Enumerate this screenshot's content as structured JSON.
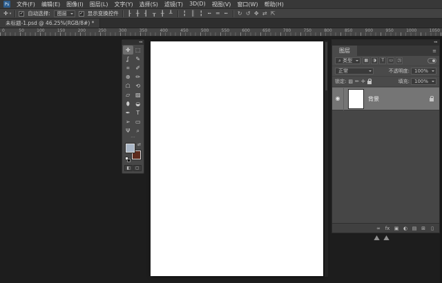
{
  "menubar": {
    "logo": "Ps",
    "items": [
      "文件(F)",
      "编辑(E)",
      "图像(I)",
      "图层(L)",
      "文字(Y)",
      "选择(S)",
      "滤镜(T)",
      "3D(D)",
      "视图(V)",
      "窗口(W)",
      "帮助(H)"
    ]
  },
  "options_bar": {
    "tool_icon": "✛",
    "auto_select_checked": "✓",
    "auto_select_label": "自动选择:",
    "auto_select_value": "图层",
    "show_transform_checked": "✓",
    "show_transform_label": "显示变换控件",
    "align_icons": [
      {
        "name": "align-left-icon",
        "glyph": "┠"
      },
      {
        "name": "align-center-h-icon",
        "glyph": "╂"
      },
      {
        "name": "align-right-icon",
        "glyph": "┨"
      },
      {
        "name": "align-top-icon",
        "glyph": "┰"
      },
      {
        "name": "align-middle-icon",
        "glyph": "╂"
      },
      {
        "name": "align-bottom-icon",
        "glyph": "┸"
      }
    ],
    "distribute_icons": [
      {
        "name": "distribute-top-icon",
        "glyph": "╏"
      },
      {
        "name": "distribute-middle-icon",
        "glyph": "║"
      },
      {
        "name": "distribute-bottom-icon",
        "glyph": "╏"
      },
      {
        "name": "distribute-left-icon",
        "glyph": "╍"
      },
      {
        "name": "distribute-center-icon",
        "glyph": "═"
      },
      {
        "name": "distribute-right-icon",
        "glyph": "╍"
      }
    ],
    "threed_icons": [
      {
        "name": "3d-rotate-icon",
        "glyph": "↻"
      },
      {
        "name": "3d-roll-icon",
        "glyph": "↺"
      },
      {
        "name": "3d-drag-icon",
        "glyph": "✥"
      },
      {
        "name": "3d-slide-icon",
        "glyph": "⇄"
      },
      {
        "name": "3d-scale-icon",
        "glyph": "⇱"
      }
    ]
  },
  "document": {
    "tab_title": "未标题-1.psd @ 46.25%(RGB/8#) *"
  },
  "ruler": {
    "labels": [
      "0",
      "50",
      "100",
      "150",
      "200",
      "250",
      "300",
      "350",
      "400",
      "450",
      "500",
      "550",
      "600",
      "650",
      "700",
      "750",
      "800",
      "850",
      "900",
      "950",
      "1000",
      "1050"
    ]
  },
  "toolbar": {
    "collapse_icon": "◂◂",
    "tools": [
      {
        "name": "tool-move",
        "glyph": "✛",
        "selected": true
      },
      {
        "name": "tool-marquee",
        "glyph": "⬚"
      },
      {
        "name": "tool-lasso",
        "glyph": "ʆ"
      },
      {
        "name": "tool-quick-select",
        "glyph": "✎"
      },
      {
        "name": "tool-crop",
        "glyph": "⌗"
      },
      {
        "name": "tool-eyedropper",
        "glyph": "✐"
      },
      {
        "name": "tool-spot-heal",
        "glyph": "⊕"
      },
      {
        "name": "tool-brush",
        "glyph": "✏"
      },
      {
        "name": "tool-clone-stamp",
        "glyph": "☖"
      },
      {
        "name": "tool-history-brush",
        "glyph": "⟲"
      },
      {
        "name": "tool-eraser",
        "glyph": "▱"
      },
      {
        "name": "tool-gradient",
        "glyph": "▨"
      },
      {
        "name": "tool-blur",
        "glyph": "⬮"
      },
      {
        "name": "tool-dodge",
        "glyph": "◒"
      },
      {
        "name": "tool-pen",
        "glyph": "✒"
      },
      {
        "name": "tool-type",
        "glyph": "T"
      },
      {
        "name": "tool-path-select",
        "glyph": "➢"
      },
      {
        "name": "tool-shape",
        "glyph": "▭"
      },
      {
        "name": "tool-hand",
        "glyph": "Ψ"
      },
      {
        "name": "tool-zoom",
        "glyph": "⌕"
      }
    ],
    "more": "···",
    "fg_color": "#a9b6c6",
    "bg_color": "#5d2b1d",
    "swap_icon": "⇄",
    "quick_mask_icon": "◧",
    "screen_mode_icon": "▢"
  },
  "layers_panel": {
    "strip_icon": "◂◂",
    "tab": "图层",
    "panel_menu_icon": "≡",
    "filter": {
      "kind_icon": "⌕",
      "kind_label": "类型",
      "icons": [
        {
          "name": "filter-pixel-icon",
          "glyph": "▦"
        },
        {
          "name": "filter-adjustment-icon",
          "glyph": "◑"
        },
        {
          "name": "filter-type-icon",
          "glyph": "T"
        },
        {
          "name": "filter-shape-icon",
          "glyph": "▭"
        },
        {
          "name": "filter-smart-object-icon",
          "glyph": "◳"
        }
      ]
    },
    "blend_mode": "正常",
    "opacity_label": "不透明度:",
    "opacity_value": "100%",
    "lock_label": "锁定:",
    "lock_glyphs": [
      "▨",
      "✏",
      "✛"
    ],
    "fill_label": "填充:",
    "fill_value": "100%",
    "layer": {
      "eye_icon": "◉",
      "name": "背景"
    },
    "bottom_icons": [
      {
        "name": "link-layers-icon",
        "glyph": "∞"
      },
      {
        "name": "layer-style-icon",
        "glyph": "fx"
      },
      {
        "name": "add-mask-icon",
        "glyph": "▣"
      },
      {
        "name": "adjustment-layer-icon",
        "glyph": "◐"
      },
      {
        "name": "new-group-icon",
        "glyph": "▤"
      },
      {
        "name": "new-layer-icon",
        "glyph": "⊞"
      },
      {
        "name": "delete-layer-icon",
        "glyph": "▯"
      }
    ]
  }
}
